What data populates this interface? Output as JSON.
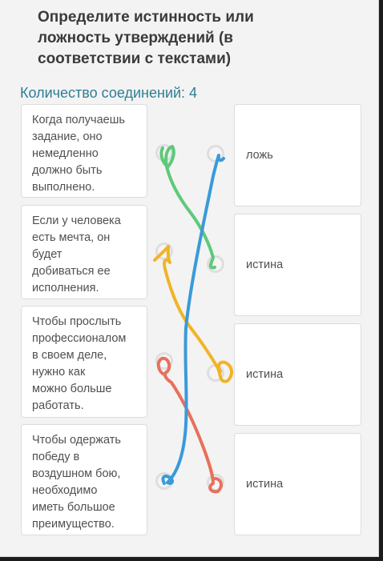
{
  "task": {
    "title": "Определите истинность или ложность утверждений (в соответствии с текстами)",
    "connections_label": "Количество соединений: 4"
  },
  "statements": [
    {
      "text": "Когда получаешь\nзадание, оно\nнемедленно\nдолжно быть\nвыполнено."
    },
    {
      "text": "Если у человека\nесть мечта, он\nбудет\nдобиваться ее\nисполнения."
    },
    {
      "text": "Чтобы прослыть\nпрофессионалом\nв своем деле,\nнужно как\nможно больше\nработать."
    },
    {
      "text": "Чтобы одержать\nпобеду в\nвоздушном бою,\nнеобходимо\nиметь большое\nпреимущество."
    }
  ],
  "answers": [
    {
      "label": "ложь"
    },
    {
      "label": "истина"
    },
    {
      "label": "истина"
    },
    {
      "label": "истина"
    }
  ],
  "connections": [
    {
      "statement": 1,
      "answer": 2,
      "color": "#5ec97a"
    },
    {
      "statement": 2,
      "answer": 3,
      "color": "#f0b429"
    },
    {
      "statement": 3,
      "answer": 4,
      "color": "#e8705c"
    },
    {
      "statement": 4,
      "answer": 1,
      "color": "#3a9ad9"
    }
  ]
}
